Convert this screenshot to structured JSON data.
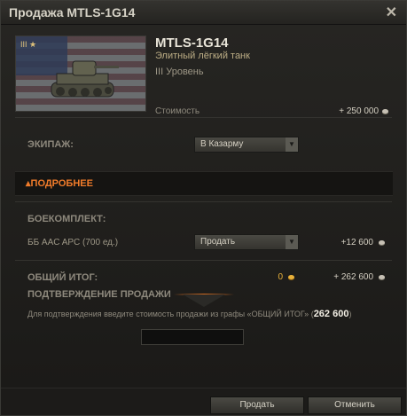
{
  "window": {
    "title": "Продажа MTLS-1G14",
    "close_icon": "close-icon"
  },
  "tank": {
    "name": "MTLS-1G14",
    "class_label": "Элитный лёгкий танк",
    "tier_roman": "III",
    "tier_label": "Уровень",
    "badge": "III ★",
    "cost_label": "Стоимость",
    "cost_value": "+ 250 000"
  },
  "crew": {
    "label": "ЭКИПАЖ:",
    "selected": "В Казарму"
  },
  "details": {
    "label": "ПОДРОБНЕЕ",
    "expanded": true
  },
  "ammo": {
    "label": "БОЕКОМПЛЕКТ:",
    "item_label": "ББ AAC APC (700 ед.)",
    "action_selected": "Продать",
    "value": "+12 600"
  },
  "total": {
    "label": "ОБЩИЙ ИТОГ:",
    "gold": "0",
    "credits": "+ 262 600"
  },
  "confirm": {
    "title": "ПОДТВЕРЖДЕНИЕ ПРОДАЖИ",
    "text_prefix": "Для подтверждения введите стоимость продажи из графы «ОБЩИЙ ИТОГ» (",
    "text_value": "262 600",
    "text_suffix": ")",
    "input_value": ""
  },
  "buttons": {
    "sell": "Продать",
    "cancel": "Отменить"
  },
  "colors": {
    "accent": "#f07b2a",
    "gold": "#e8b13a",
    "silver": "#c6c0b4"
  }
}
